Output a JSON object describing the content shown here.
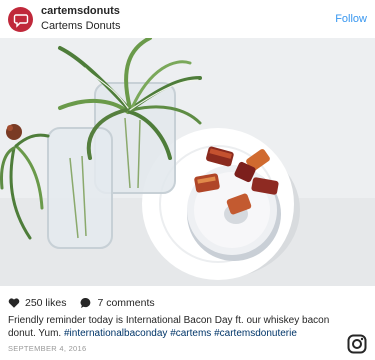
{
  "post": {
    "username": "cartemsdonuts",
    "location": "Cartems Donuts",
    "follow_label": "Follow",
    "likes": "250 likes",
    "comments": "7 comments",
    "caption_text": "Friendly reminder today is International Bacon Day ft. our whiskey bacon donut. Yum.",
    "hashtags": [
      "#internationalbaconday",
      "#cartems",
      "#cartemsdonuterie"
    ],
    "date": "SEPTEMBER 4, 2016"
  },
  "colors": {
    "avatar": "#c0283a",
    "follow": "#3897f0",
    "hashtag": "#003569",
    "muted": "#999999"
  },
  "icons": {
    "avatar": "speech-bubble-icon",
    "likes": "heart-icon",
    "comments": "comment-bubble-icon",
    "brand": "instagram-icon"
  }
}
